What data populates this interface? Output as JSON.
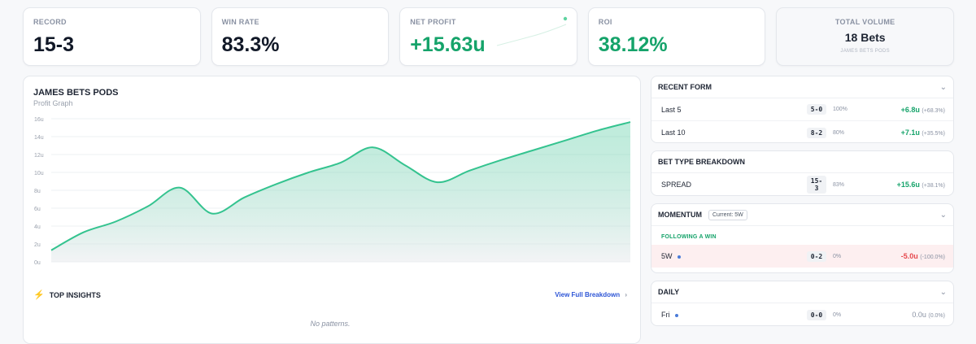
{
  "stats": {
    "record": {
      "label": "RECORD",
      "value": "15-3"
    },
    "win_rate": {
      "label": "WIN RATE",
      "value": "83.3%"
    },
    "net_profit": {
      "label": "NET PROFIT",
      "value": "+15.63u"
    },
    "roi": {
      "label": "ROI",
      "value": "38.12%"
    },
    "volume": {
      "label": "TOTAL VOLUME",
      "value": "18 Bets",
      "sub": "JAMES BETS PODS"
    }
  },
  "colors": {
    "green": "#15a36a",
    "red": "#e5484d",
    "link": "#2d55d6"
  },
  "graph": {
    "title": "JAMES BETS PODS",
    "subtitle": "Profit Graph"
  },
  "chart_data": {
    "type": "area",
    "title": "JAMES BETS PODS",
    "subtitle": "Profit Graph",
    "y_ticks": [
      "16u",
      "14u",
      "12u",
      "10u",
      "8u",
      "6u",
      "4u",
      "2u",
      "0u"
    ],
    "ylim": [
      0,
      16
    ],
    "x": [
      0,
      1,
      2,
      3,
      4,
      5,
      6,
      7,
      8,
      9,
      10,
      11,
      12,
      13,
      14,
      15,
      16,
      17,
      18
    ],
    "values": [
      1.3,
      3.3,
      4.5,
      6.2,
      8.3,
      5.4,
      7.2,
      8.7,
      10.0,
      11.1,
      12.8,
      10.8,
      8.9,
      10.2,
      11.4,
      12.5,
      13.6,
      14.7,
      15.63
    ],
    "grid": true,
    "color": "#34c38f"
  },
  "insights": {
    "title": "TOP INSIGHTS",
    "link": "View Full Breakdown",
    "empty": "No patterns."
  },
  "recent_form": {
    "title": "RECENT FORM",
    "rows": [
      {
        "name": "Last 5",
        "record": "5-0",
        "pct": "100%",
        "units": "+6.8u",
        "roi": "(+68.3%)"
      },
      {
        "name": "Last 10",
        "record": "8-2",
        "pct": "80%",
        "units": "+7.1u",
        "roi": "(+35.5%)"
      }
    ]
  },
  "bet_type": {
    "title": "BET TYPE BREAKDOWN",
    "rows": [
      {
        "name": "SPREAD",
        "record": "15-3",
        "pct": "83%",
        "units": "+15.6u",
        "roi": "(+38.1%)"
      }
    ]
  },
  "momentum": {
    "title": "MOMENTUM",
    "badge": "Current: 5W",
    "section": "FOLLOWING A WIN",
    "rows": [
      {
        "name": "5W",
        "record": "0-2",
        "pct": "0%",
        "units": "-5.0u",
        "roi": "(-100.0%)"
      }
    ]
  },
  "daily": {
    "title": "DAILY",
    "rows": [
      {
        "name": "Fri",
        "record": "0-0",
        "pct": "0%",
        "units": "0.0u",
        "roi": "(0.0%)"
      }
    ]
  }
}
